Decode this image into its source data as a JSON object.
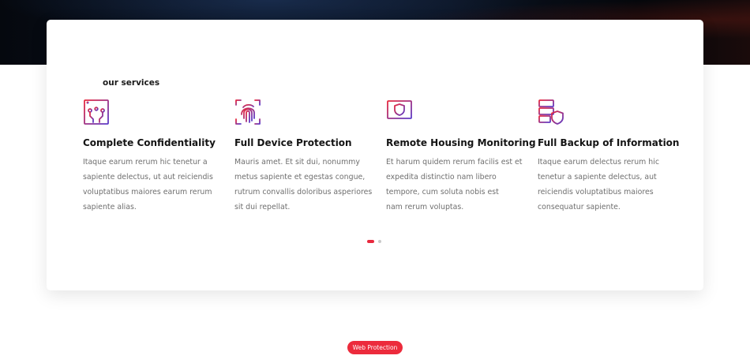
{
  "section": {
    "label": "our services"
  },
  "services": [
    {
      "icon": "browser-circuit-icon",
      "title": "Complete Confidentiality",
      "description": "Itaque earum rerum hic tenetur a\nsapiente delectus, ut aut reiciendis\nvoluptatibus maiores earum rerum\nsapiente alias."
    },
    {
      "icon": "fingerprint-icon",
      "title": "Full Device Protection",
      "description": "Mauris amet. Et sit dui, nonummy\nmetus sapiente et egestas congue,\nrutrum convallis doloribus asperiores\nsit dui repellat."
    },
    {
      "icon": "monitor-shield-icon",
      "title": "Remote Housing Monitoring",
      "description": "Et harum quidem rerum facilis est et\nexpedita distinctio nam libero\ntempore, cum soluta nobis est\nnam rerum voluptas."
    },
    {
      "icon": "server-shield-icon",
      "title": "Full Backup of Information",
      "description": "Itaque earum delectus rerum hic\ntenetur a sapiente delectus, aut\nreiciendis voluptatibus maiores\nconsequatur sapiente."
    }
  ],
  "carousel": {
    "active_slide": 1,
    "slide_count": 2
  },
  "next_section": {
    "pill_label": "Web Protection"
  },
  "colors": {
    "accent_red": "#e8293e",
    "accent_purple": "#5b3bc9",
    "title_text": "#141414",
    "body_text": "#6f6f6f"
  }
}
